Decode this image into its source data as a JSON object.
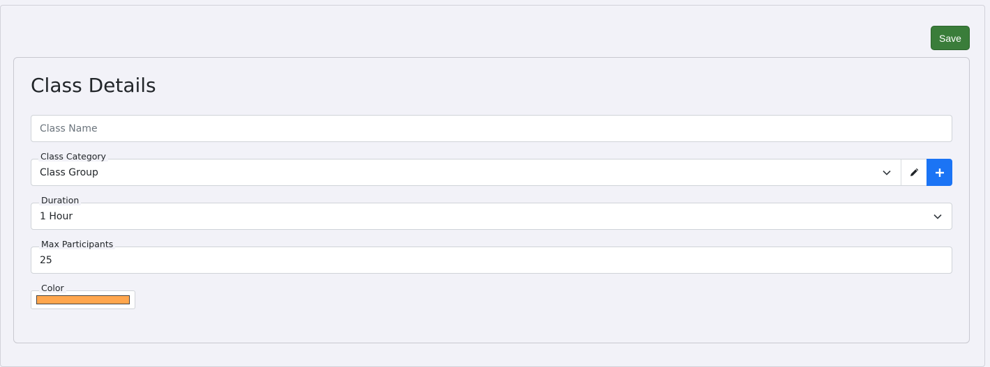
{
  "toolbar": {
    "save_label": "Save"
  },
  "card": {
    "title": "Class Details"
  },
  "form": {
    "class_name": {
      "placeholder": "Class Name",
      "value": ""
    },
    "class_category": {
      "label": "Class Category",
      "value": "Class Group"
    },
    "duration": {
      "label": "Duration",
      "value": "1 Hour"
    },
    "max_participants": {
      "label": "Max Participants",
      "value": "25"
    },
    "color": {
      "label": "Color",
      "value": "#ffa64d"
    }
  },
  "icons": {
    "edit": "pencil-icon",
    "add": "plus-icon",
    "dropdown": "chevron-down-icon"
  },
  "colors": {
    "save_button": "#3a7d3a",
    "add_button": "#1b74f5",
    "page_background": "#f2f2f8"
  }
}
